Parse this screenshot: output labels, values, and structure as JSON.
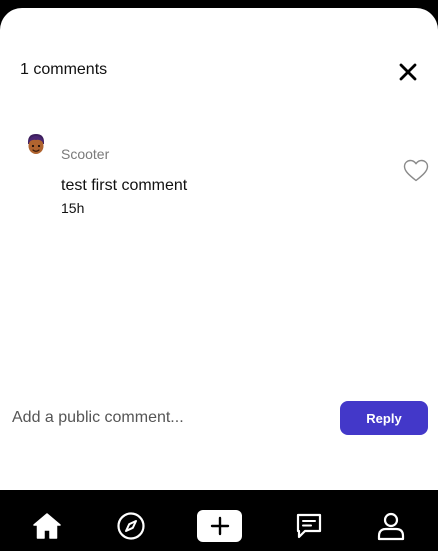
{
  "header": {
    "title": "1 comments"
  },
  "comments": [
    {
      "author": "Scooter",
      "text": "test first comment",
      "time": "15h",
      "liked": false
    }
  ],
  "composer": {
    "placeholder": "Add a public comment...",
    "value": "",
    "reply_label": "Reply"
  },
  "colors": {
    "accent": "#4338c9",
    "background": "#000000",
    "sheet": "#ffffff"
  },
  "nav": {
    "items": [
      {
        "icon": "home-icon"
      },
      {
        "icon": "compass-icon"
      },
      {
        "icon": "plus-icon"
      },
      {
        "icon": "message-icon"
      },
      {
        "icon": "user-icon"
      }
    ]
  }
}
